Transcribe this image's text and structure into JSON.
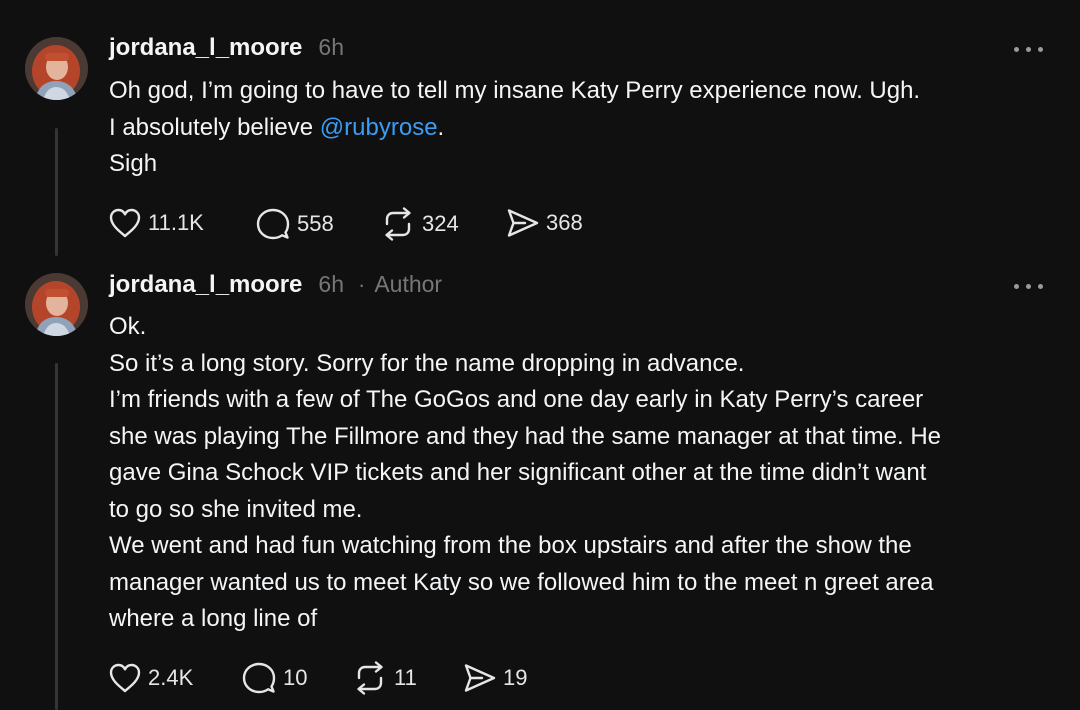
{
  "posts": [
    {
      "username": "jordana_l_moore",
      "time": "6h",
      "author_separator": "",
      "author_label": "",
      "body_lines": [
        [
          "Oh god, I’m going to have to tell my insane Katy Perry experience now. Ugh."
        ],
        [
          "I absolutely believe ",
          "@rubyrose",
          "."
        ],
        [
          "Sigh"
        ]
      ],
      "actions": {
        "likes": "11.1K",
        "replies": "558",
        "reposts": "324",
        "shares": "368"
      }
    },
    {
      "username": "jordana_l_moore",
      "time": "6h",
      "author_separator": "·",
      "author_label": "Author",
      "body_lines": [
        "Ok.",
        "So it’s a long story. Sorry for the name dropping in advance.",
        "I’m friends with a few of The GoGos and one day early in Katy Perry’s career",
        "she was playing The Fillmore and they had the same manager at that time. He",
        "gave Gina Schock VIP tickets and her significant other at the time didn’t want",
        "to go so she invited me.",
        "We went and had fun watching from the box upstairs and after the show the",
        "manager wanted us to meet Katy so we followed him to the meet n greet area",
        "where a long line of"
      ],
      "actions": {
        "likes": "2.4K",
        "replies": "10",
        "reposts": "11",
        "shares": "19"
      }
    }
  ],
  "icons": {
    "like": "heart-icon",
    "reply": "comment-icon",
    "repost": "repost-icon",
    "share": "send-icon",
    "more": "more-options-icon"
  },
  "colors": {
    "background": "#101010",
    "text": "#f3f5f7",
    "secondary": "#777777",
    "mention": "#3b9cf5",
    "thread_line": "#333638"
  }
}
